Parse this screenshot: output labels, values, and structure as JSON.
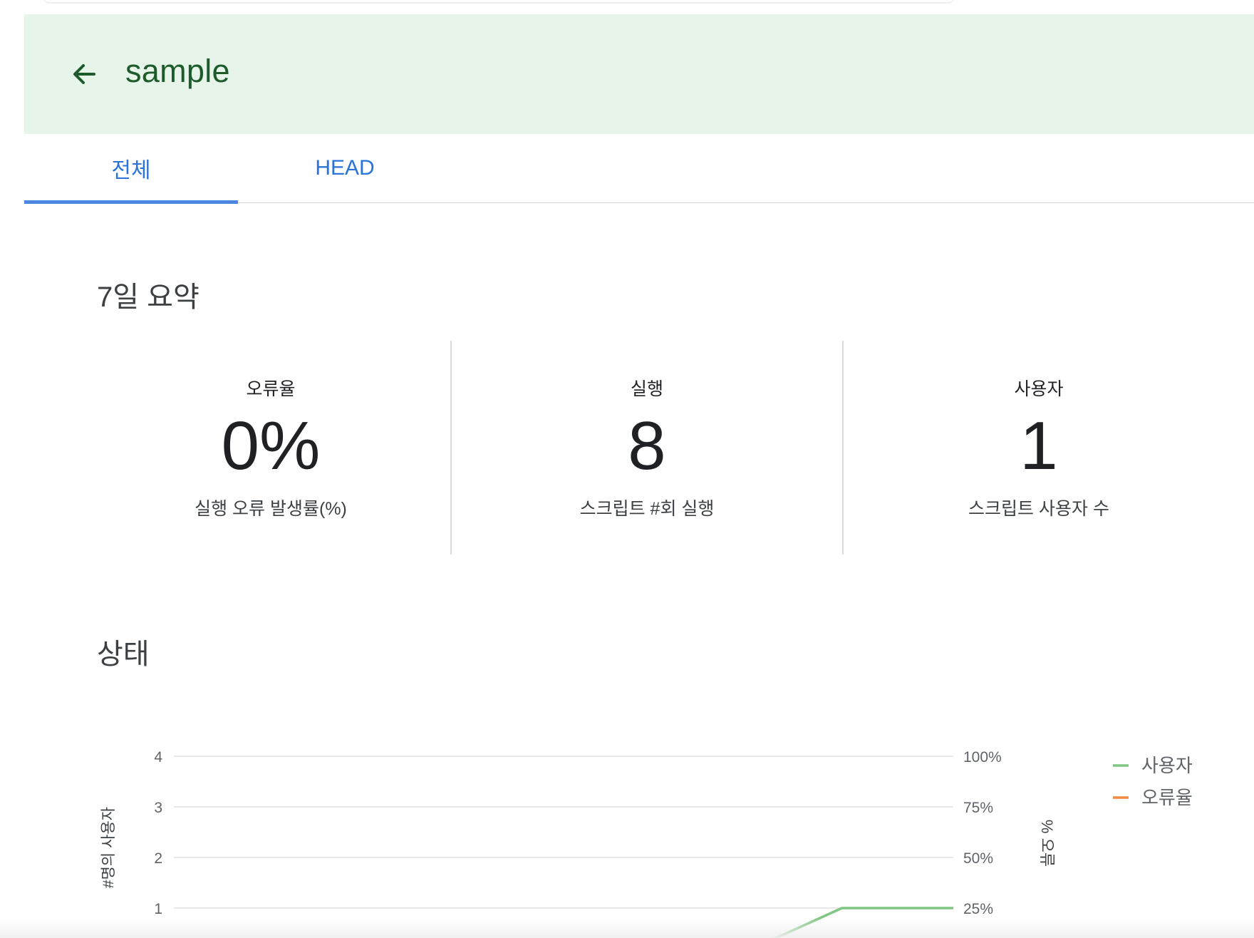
{
  "header": {
    "title": "sample",
    "back_icon": "arrow-left-icon",
    "background_color": "#e6f4ea",
    "title_color": "#1e5b2a"
  },
  "tabs": [
    {
      "label": "전체",
      "active": true
    },
    {
      "label": "HEAD",
      "active": false
    }
  ],
  "summary": {
    "title": "7일 요약",
    "metrics": [
      {
        "label": "오류율",
        "value": "0%",
        "description": "실행 오류 발생률(%)"
      },
      {
        "label": "실행",
        "value": "8",
        "description": "스크립트 #회 실행"
      },
      {
        "label": "사용자",
        "value": "1",
        "description": "스크립트 사용자 수"
      }
    ]
  },
  "status": {
    "title": "상태"
  },
  "chart_data": {
    "type": "line",
    "left_axis": {
      "label": "#명의 사용자",
      "ticks": [
        "4",
        "3",
        "2",
        "1"
      ],
      "range": [
        0,
        4
      ]
    },
    "right_axis": {
      "label": "% 오류",
      "ticks": [
        "100%",
        "75%",
        "50%",
        "25%"
      ],
      "range": [
        0,
        100
      ]
    },
    "grid": true,
    "legend_position": "top-right",
    "series": [
      {
        "name": "사용자",
        "color": "#81c784",
        "axis": "left",
        "x": [
          5,
          6,
          7
        ],
        "values": [
          0,
          1,
          1
        ]
      },
      {
        "name": "오류율",
        "color": "#f08a3e",
        "axis": "right",
        "x": [],
        "values": []
      }
    ],
    "x_range": [
      0,
      7
    ],
    "visible_y_min": 0.45
  }
}
